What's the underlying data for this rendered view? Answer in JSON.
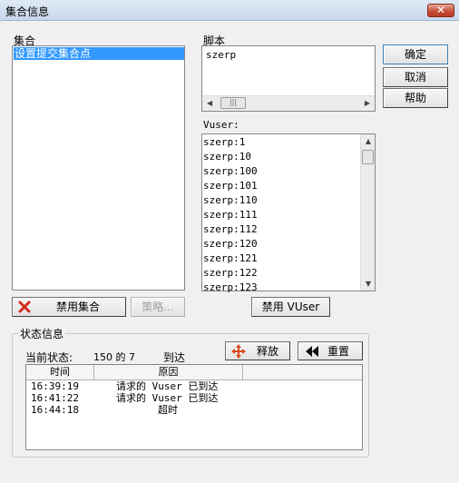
{
  "window": {
    "title": "集合信息",
    "close_label": "✕"
  },
  "rendezvous": {
    "label": "集合",
    "items": [
      "设置提交集合点"
    ],
    "disable_button": "禁用集合",
    "policy_button": "策略..."
  },
  "script": {
    "label": "脚本",
    "items": [
      "szerp"
    ]
  },
  "vuser": {
    "label": "Vuser:",
    "items": [
      "szerp:1",
      "szerp:10",
      "szerp:100",
      "szerp:101",
      "szerp:110",
      "szerp:111",
      "szerp:112",
      "szerp:120",
      "szerp:121",
      "szerp:122",
      "szerp:123"
    ],
    "disable_button": "禁用 VUser"
  },
  "buttons": {
    "ok": "确定",
    "cancel": "取消",
    "help": "帮助"
  },
  "status": {
    "group_label": "状态信息",
    "current_label": "当前状态:",
    "count_text": "150 的 7",
    "arrived_label": "到达",
    "release_button": "释放",
    "reset_button": "重置",
    "columns": [
      "时间",
      "原因"
    ],
    "rows": [
      {
        "time": "16:39:19",
        "reason": "请求的 Vuser 已到达"
      },
      {
        "time": "16:41:22",
        "reason": "请求的 Vuser 已到达"
      },
      {
        "time": "16:44:18",
        "reason": "超时"
      }
    ]
  },
  "colors": {
    "selection": "#3399ff",
    "delete_icon": "#d42a1a",
    "release_icon": "#d94a1a"
  },
  "icons": {
    "delete": "x-icon",
    "release": "move-icon",
    "reset": "rewind-icon"
  }
}
